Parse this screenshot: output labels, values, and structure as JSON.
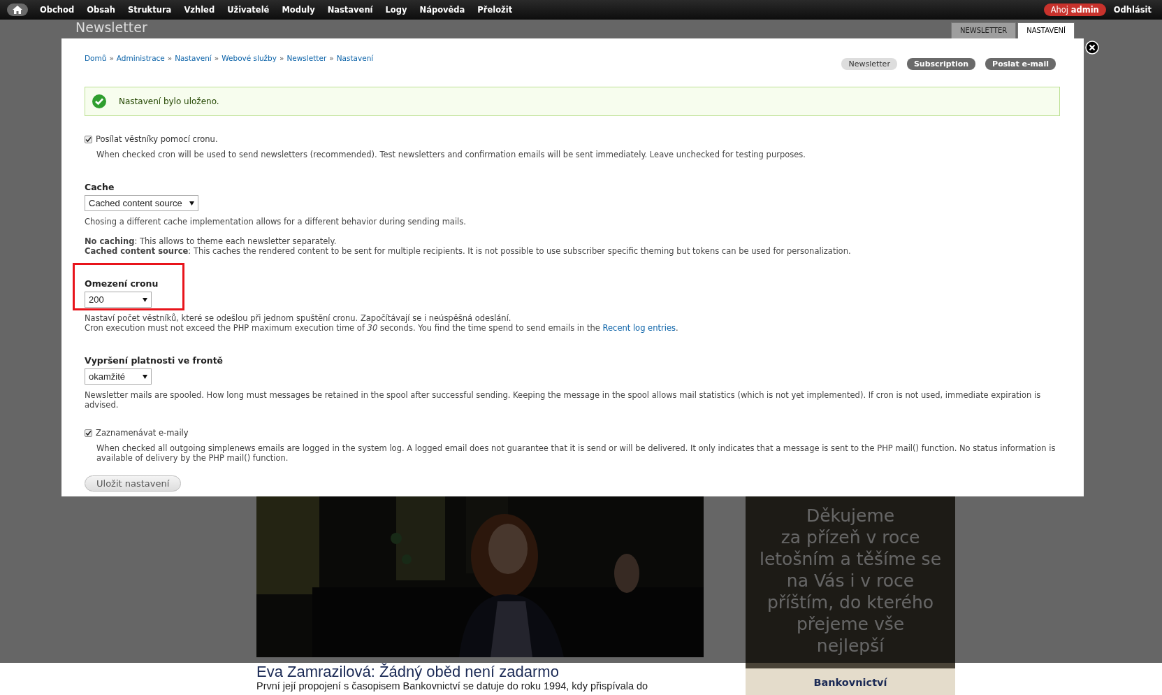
{
  "toolbar": {
    "menu": [
      "Obchod",
      "Obsah",
      "Struktura",
      "Vzhled",
      "Uživatelé",
      "Moduly",
      "Nastavení",
      "Logy",
      "Nápověda",
      "Přeložit"
    ],
    "greeting": "Ahoj **admin**",
    "logout": "Odhlásit"
  },
  "overlay": {
    "title": "Newsletter",
    "tabs": [
      {
        "label": "NEWSLETTER",
        "selected": false
      },
      {
        "label": "NASTAVENÍ",
        "selected": true
      }
    ]
  },
  "breadcrumb": {
    "separator": "»",
    "items": [
      "Domů",
      "Administrace",
      "Nastavení",
      "Webové služby",
      "Newsletter",
      "Nastavení"
    ]
  },
  "action_links": [
    {
      "label": "Newsletter",
      "selected": true
    },
    {
      "label": "Subscription",
      "selected": false
    },
    {
      "label": "Poslat e-mail",
      "selected": false
    }
  ],
  "message": {
    "kind": "status",
    "text": "Nastavení bylo uloženo."
  },
  "fields": [
    {
      "kind": "checkbox",
      "label": "Posílat věstníky pomocí cronu.",
      "checked": true,
      "description": [
        [
          "When checked cron will be used to send newsletters (recommended). Test newsletters and confirmation emails will be sent immediately. Leave unchecked for testing purposes."
        ]
      ]
    },
    {
      "kind": "select",
      "label": "Cache",
      "value": "Cached content source",
      "description": [
        [
          "Chosing a different cache implementation allows for a different behavior during sending mails."
        ],
        [
          "**No caching**: This allows to theme each newsletter separately.",
          "**Cached content source**: This caches the rendered content to be sent for multiple recipients. It is not possible to use subscriber specific theming but tokens can be used for personalization."
        ]
      ]
    },
    {
      "kind": "select",
      "label": "Omezení cronu",
      "value": "200",
      "highlighted": true,
      "description": [
        [
          "Nastaví počet věstníků, které se odešlou při jednom spuštění cronu. Započítávají se i neúspěšná odeslání."
        ]
      ],
      "note": {
        "text": "Cron execution must not exceed the PHP maximum execution time of *30* seconds. You find the time spend to send emails in the",
        "link": "Recent log entries",
        "after": "."
      }
    },
    {
      "kind": "select",
      "label": "Vypršení platnosti ve frontě",
      "value": "okamžité",
      "description": [
        [
          "Newsletter mails are spooled. How long must messages be retained in the spool after successful sending. Keeping the message in the spool allows mail statistics (which is not yet implemented). If cron is not used, immediate expiration is advised."
        ]
      ]
    },
    {
      "kind": "checkbox",
      "label": "Zaznamenávat e-maily",
      "checked": true,
      "description": [
        [
          "When checked all outgoing simplenews emails are logged in the system log. A logged email does not guarantee that it is send or will be delivered. It only indicates that a message is sent to the PHP mail() function. No status information is available of delivery by the PHP mail() function."
        ]
      ]
    }
  ],
  "submit": "Uložit nastavení",
  "background": {
    "article_title": "Eva Zamrazilová: Žádný oběd není zadarmo",
    "article_teaser": "První její propojení s časopisem Bankovnictví se datuje do roku 1994, kdy přispívala do",
    "ad_lines": [
      "Děkujeme",
      "za přízeň v roce",
      "letošním a těšíme se",
      "na Vás i v roce",
      "příštím, do kterého",
      "přejeme vše",
      "nejlepší"
    ],
    "ad_label": "Bankovnictví"
  }
}
